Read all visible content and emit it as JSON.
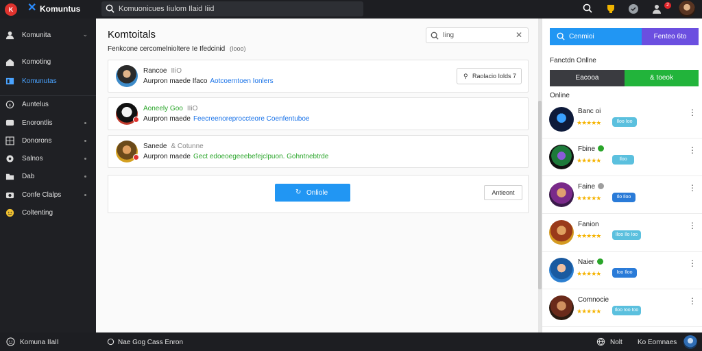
{
  "app": {
    "brand": "Komuntus",
    "search_text": "Komuonicues Iiulom Ilaid Iiid"
  },
  "topbar": {
    "notif_count": "2"
  },
  "sidebar": {
    "items": [
      {
        "label": "Komunita",
        "icon": "users-icon",
        "kind": "chevron"
      },
      {
        "label": "Komoting",
        "icon": "home-icon",
        "kind": "none"
      },
      {
        "label": "Komunutas",
        "icon": "community-icon",
        "kind": "none",
        "active": true
      },
      {
        "label": "Auntelus",
        "icon": "info-icon",
        "kind": "none"
      },
      {
        "label": "Enorontlis",
        "icon": "message-icon",
        "kind": "dot"
      },
      {
        "label": "Donorons",
        "icon": "grid-icon",
        "kind": "dot"
      },
      {
        "label": "Salnos",
        "icon": "settings-icon",
        "kind": "dot"
      },
      {
        "label": "Dab",
        "icon": "folder-icon",
        "kind": "dot"
      },
      {
        "label": "Confe Clalps",
        "icon": "camera-icon",
        "kind": "dot"
      },
      {
        "label": "Coltenting",
        "icon": "emoji-icon",
        "kind": "none"
      }
    ]
  },
  "main": {
    "title": "Komtoitals",
    "subtitle": "Fenkcone cercomelnioltere Ie Ifedcinid",
    "subtitle_tag": "(Iooo)",
    "search_placeholder": "Iing",
    "cards": [
      {
        "name": "Rancoe",
        "meta": "IIiO",
        "desc": "Aurpron maede Ifaco",
        "link": "Aotcoerntoen Ionlers",
        "follow_label": "Raolacio Iolds 7",
        "accent": "blue"
      },
      {
        "name": "Aoneely Goo",
        "meta": "IIiO",
        "desc": "Aurpron maede",
        "link": "Feecreenoreproccteore Coenfentuboe",
        "accent": "green"
      },
      {
        "name": "Sanede",
        "meta": "& Cotunne",
        "desc": "Aurpron maede",
        "link": "Gect edoeoegeeebefejclpuon. Gohntnebtrde",
        "accent": "green"
      }
    ],
    "online_button": "Onliole",
    "secondary_button": "Antieont"
  },
  "right": {
    "tab_a": "Cenmioi",
    "tab_b": "Fenteo 6to",
    "heading": "Fanctdn Onllne",
    "toggle_a": "Eacooa",
    "toggle_b": "& toeok",
    "online_label": "Online",
    "friends": [
      {
        "name": "Banc oi",
        "badge": "Iloo Ioo",
        "badge_color": "#5bc0de",
        "verified": ""
      },
      {
        "name": "Fbine",
        "badge": "Iloo",
        "badge_color": "#5bc0de",
        "verified": "#2aa52a"
      },
      {
        "name": "Faine",
        "badge": "Ilo Iloo",
        "badge_color": "#2a7bd8",
        "verified": "#9e9e9e"
      },
      {
        "name": "Fanion",
        "badge": "Iloo Ilo Ioo",
        "badge_color": "#5bc0de",
        "verified": ""
      },
      {
        "name": "Naier",
        "badge": "Ioo Iloo",
        "badge_color": "#2a7bd8",
        "verified": "#2aa52a"
      },
      {
        "name": "Comnocie",
        "badge": "Iloo Ioo Ioo",
        "badge_color": "#5bc0de",
        "verified": ""
      }
    ]
  },
  "bottom": {
    "left_label": "Komuna IIaII",
    "center_label": "Nae Gog Cass Enron",
    "right_a": "Nolt",
    "right_b": "Ko Eomnaes"
  }
}
